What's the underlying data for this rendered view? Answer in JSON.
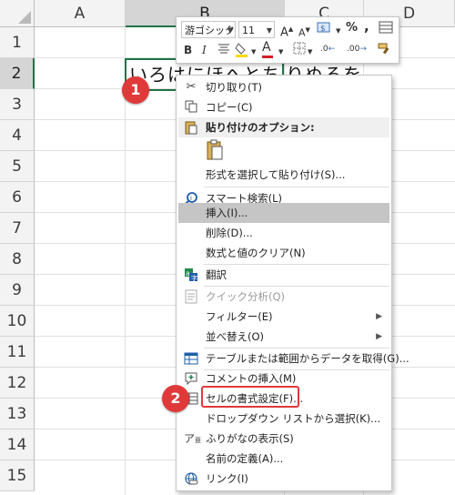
{
  "sheet": {
    "columns": [
      "A",
      "B",
      "C",
      "D"
    ],
    "rows": [
      "1",
      "2",
      "3",
      "4",
      "5",
      "6",
      "7",
      "8",
      "9",
      "10",
      "11",
      "12",
      "13",
      "14",
      "15"
    ],
    "cell_b2_text": "いろはにほへとち",
    "cell_c2_text": "りぬるを"
  },
  "mini_toolbar": {
    "font_name": "游ゴシック",
    "font_size": "11",
    "grow_icon": "A",
    "shrink_icon": "A",
    "percent": "%",
    "comma": ",",
    "bold": "B",
    "italic": "I",
    "font_color_letter": "A",
    "inc_decimal": ".0",
    "dec_decimal": ".00"
  },
  "menu": {
    "items": [
      {
        "label": "切り取り(T)",
        "icon": "scissors-icon"
      },
      {
        "label": "コピー(C)",
        "icon": "copy-icon"
      },
      {
        "label": "貼り付けのオプション:",
        "icon": "paste-icon"
      },
      {
        "label": "形式を選択して貼り付け(S)...",
        "icon": ""
      },
      {
        "label": "スマート検索(L)",
        "icon": "smart-lookup-icon"
      },
      {
        "label": "挿入(I)...",
        "icon": ""
      },
      {
        "label": "削除(D)...",
        "icon": ""
      },
      {
        "label": "数式と値のクリア(N)",
        "icon": ""
      },
      {
        "label": "翻訳",
        "icon": "translate-icon"
      },
      {
        "label": "クイック分析(Q)",
        "icon": "quick-analysis-icon"
      },
      {
        "label": "フィルター(E)",
        "icon": ""
      },
      {
        "label": "並べ替え(O)",
        "icon": ""
      },
      {
        "label": "テーブルまたは範囲からデータを取得(G)...",
        "icon": "table-icon"
      },
      {
        "label": "コメントの挿入(M)",
        "icon": "comment-icon"
      },
      {
        "label": "セルの書式設定(F)...",
        "icon": "format-cells-icon"
      },
      {
        "label": "ドロップダウン リストから選択(K)...",
        "icon": ""
      },
      {
        "label": "ふりがなの表示(S)",
        "icon": "furigana-icon"
      },
      {
        "label": "名前の定義(A)...",
        "icon": ""
      },
      {
        "label": "リンク(I)",
        "icon": "link-icon"
      }
    ]
  },
  "annotations": {
    "badge1": "1",
    "badge2": "2",
    "badge_color": "#e0393a"
  },
  "colors": {
    "selection_green": "#217346",
    "highlight": "#c5c5c5"
  }
}
